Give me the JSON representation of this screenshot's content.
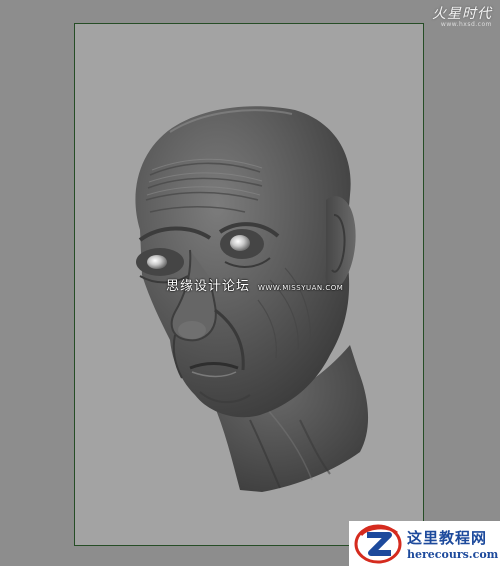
{
  "watermark_top": {
    "title": "火星时代",
    "url": "www.hxsd.com"
  },
  "watermark_center": {
    "chinese": "思缘设计论坛",
    "url": "WWW.MISSYUAN.COM"
  },
  "logo": {
    "title": "这里教程网",
    "url": "herecours.com",
    "brand_color": "#1d4a9c",
    "accent_color": "#d52b1e"
  },
  "viewport": {
    "background_color": "#8d8d8d",
    "gate_color": "#a3a3a3",
    "gate_border_color": "#264d26"
  }
}
